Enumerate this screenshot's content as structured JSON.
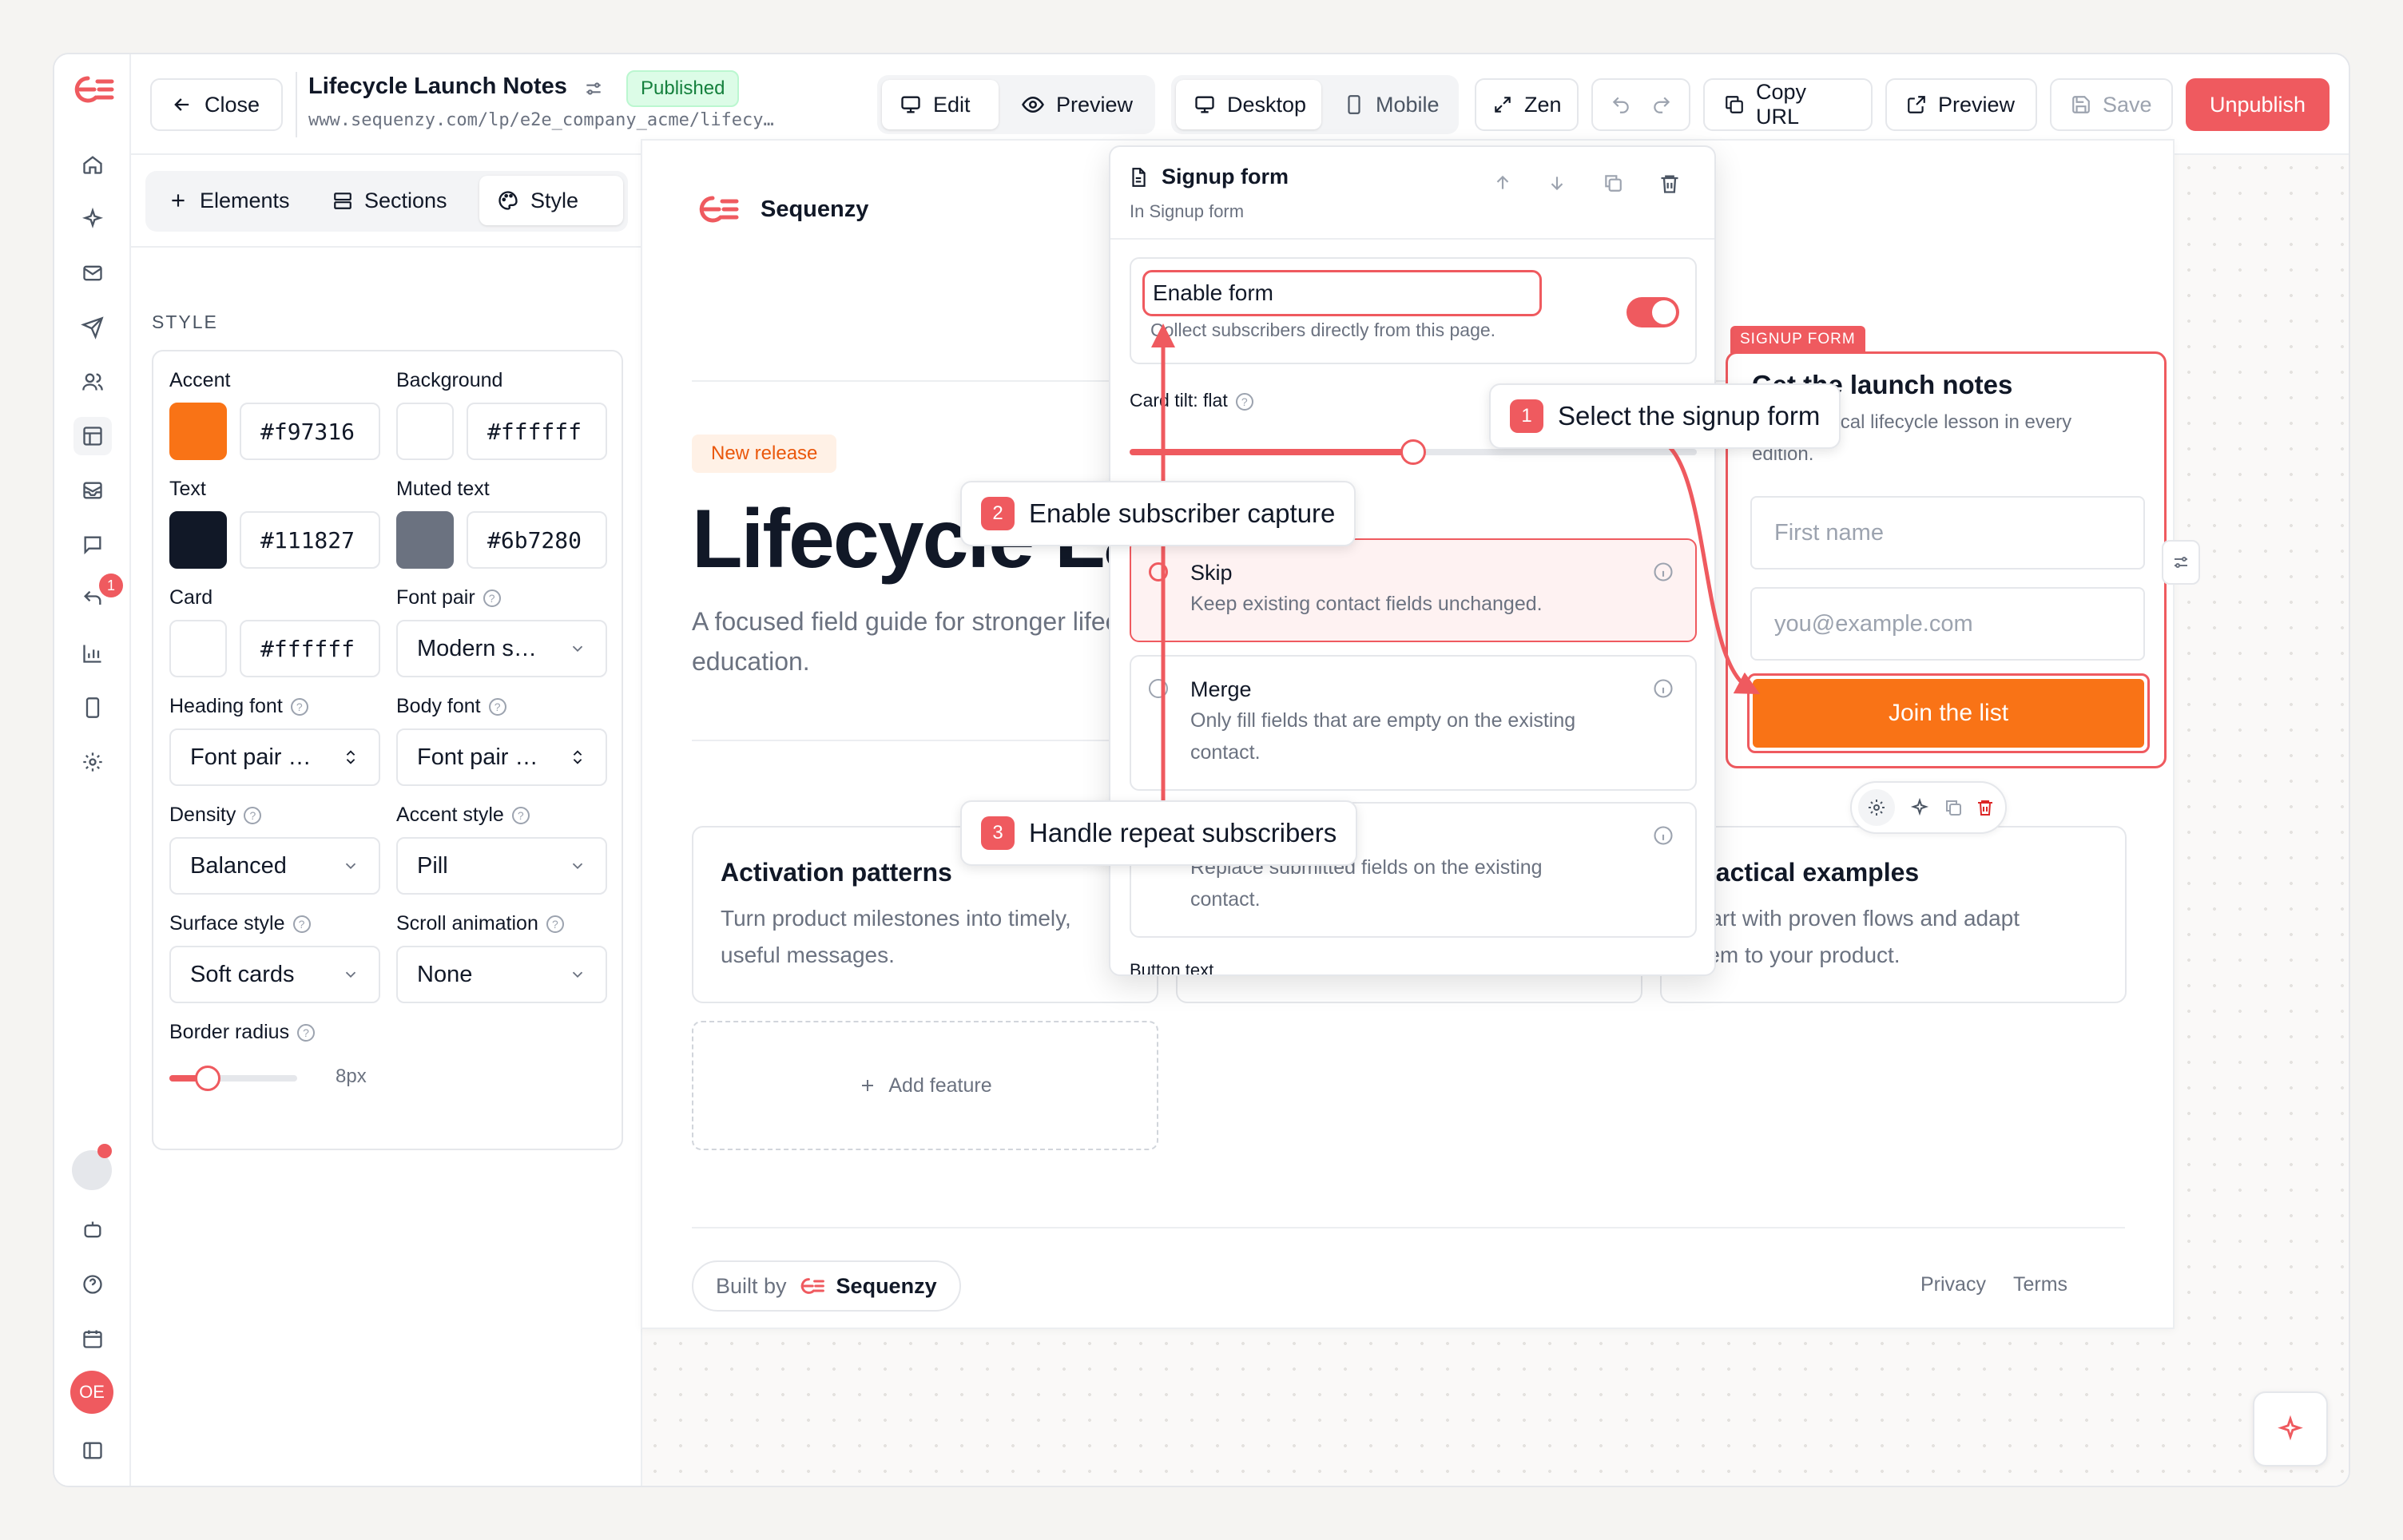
{
  "colors": {
    "brand": "#ef5a5f",
    "accent": "#f97316",
    "published_bg": "#dcfce7",
    "published_text": "#15803d"
  },
  "rail": {
    "items": [
      "home-icon",
      "sparkle-icon",
      "mail-icon",
      "send-icon",
      "users-icon",
      "layout-icon",
      "inbox-icon",
      "chat-icon",
      "reply-icon",
      "chart-icon",
      "device-icon",
      "gear-icon"
    ],
    "notif_badge": "1",
    "bottom": [
      "status-dot",
      "robot-icon",
      "help-icon",
      "calendar-icon"
    ],
    "avatar_initials": "OE"
  },
  "header": {
    "close_label": "Close",
    "title": "Lifecycle Launch Notes",
    "status_badge": "Published",
    "url": "www.sequenzy.com/lp/e2e_company_acme/lifecy…",
    "mode_edit": "Edit",
    "mode_preview": "Preview",
    "view_desktop": "Desktop",
    "view_mobile": "Mobile",
    "zen_label": "Zen",
    "copy_url_label": "Copy URL",
    "preview_label": "Preview",
    "save_label": "Save",
    "unpublish_label": "Unpublish"
  },
  "left_panel": {
    "tabs": [
      "Elements",
      "Sections",
      "Style"
    ],
    "active_tab": "Style",
    "section_title": "STYLE",
    "accent_label": "Accent",
    "accent_value": "#f97316",
    "background_label": "Background",
    "background_value": "#ffffff",
    "text_label": "Text",
    "text_value": "#111827",
    "muted_label": "Muted text",
    "muted_value": "#6b7280",
    "card_label": "Card",
    "card_value": "#ffffff",
    "font_pair_label": "Font pair",
    "font_pair_value": "Modern s…",
    "heading_font_label": "Heading font",
    "heading_font_value": "Font pair …",
    "body_font_label": "Body font",
    "body_font_value": "Font pair …",
    "density_label": "Density",
    "density_value": "Balanced",
    "accent_style_label": "Accent style",
    "accent_style_value": "Pill",
    "surface_label": "Surface style",
    "surface_value": "Soft cards",
    "scroll_label": "Scroll animation",
    "scroll_value": "None",
    "radius_label": "Border radius",
    "radius_value": "8px",
    "radius_slider_fraction": 0.3
  },
  "page": {
    "brand": "Sequenzy",
    "badge": "New release",
    "hero_title": "Lifecycle Launch Notes",
    "hero_sub_1": "A focused field guide for stronger lifecycle",
    "hero_sub_2": "education.",
    "features": [
      {
        "title": "Activation patterns",
        "desc_1": "Turn product milestones into timely,",
        "desc_2": "useful messages."
      },
      {
        "title": "",
        "desc_1": "",
        "desc_2": ""
      },
      {
        "title": "Practical examples",
        "desc_1": "Start with proven flows and adapt",
        "desc_2": "them to your product."
      }
    ],
    "add_feature": "Add feature",
    "footer_built_by": "Built by",
    "footer_brand": "Sequenzy",
    "footer_privacy": "Privacy",
    "footer_terms": "Terms"
  },
  "signup": {
    "tag": "SIGNUP FORM",
    "title": "Get the launch notes",
    "desc_1": "One practical lifecycle lesson in every",
    "desc_2": "edition.",
    "first_name_placeholder": "First name",
    "email_placeholder": "you@example.com",
    "button": "Join the list"
  },
  "popup": {
    "title": "Signup form",
    "subtitle": "In Signup form",
    "enable_label": "Enable form",
    "enable_desc": "Collect subscribers directly from this page.",
    "enable_on": true,
    "tilt_label": "Card tilt: flat",
    "tilt_fraction": 0.5,
    "options": [
      {
        "title": "Skip",
        "desc_1": "Keep existing contact fields unchanged.",
        "desc_2": "",
        "selected": true
      },
      {
        "title": "Merge",
        "desc_1": "Only fill fields that are empty on the existing",
        "desc_2": "contact.",
        "selected": false
      },
      {
        "title": "",
        "desc_1": "Replace submitted fields on the existing",
        "desc_2": "contact.",
        "selected": false
      }
    ],
    "button_text_label": "Button text"
  },
  "callouts": [
    {
      "num": "1",
      "text": "Select the signup form"
    },
    {
      "num": "2",
      "text": "Enable subscriber capture"
    },
    {
      "num": "3",
      "text": "Handle repeat subscribers"
    }
  ]
}
